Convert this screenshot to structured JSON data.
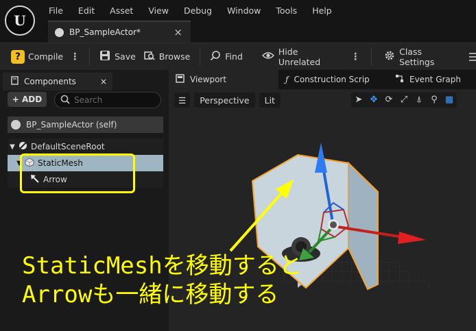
{
  "menu": [
    "File",
    "Edit",
    "Asset",
    "View",
    "Debug",
    "Window",
    "Tools",
    "Help"
  ],
  "doc_tab": {
    "title": "BP_SampleActor*",
    "close": "×"
  },
  "toolbar": {
    "compile": "Compile",
    "save": "Save",
    "browse": "Browse",
    "find": "Find",
    "hide_unrelated": "Hide Unrelated",
    "class_settings": "Class Settings",
    "kebab": "⋮"
  },
  "components_panel": {
    "tab": "Components",
    "close": "×",
    "add_label": "+ ADD",
    "search_placeholder": "Search",
    "self_label": "BP_SampleActor (self)",
    "tree": [
      {
        "label": "DefaultSceneRoot",
        "selected": false
      },
      {
        "label": "StaticMesh",
        "selected": true
      },
      {
        "label": "Arrow",
        "selected": false
      }
    ]
  },
  "viewport_tabs": [
    "Viewport",
    "Construction Scrip",
    "Event Graph"
  ],
  "viewport_toolbar": {
    "menu": "☰",
    "perspective": "Perspective",
    "lit": "Lit"
  },
  "annotation": {
    "line1": "StaticMeshを移動すると",
    "line2": "Arrowも一緒に移動する"
  },
  "colors": {
    "highlight": "#ffff00",
    "selection": "#9fb5c1",
    "gizmo_x": "#e02020",
    "gizmo_y": "#2a8a2a",
    "gizmo_z": "#1e63d8"
  }
}
